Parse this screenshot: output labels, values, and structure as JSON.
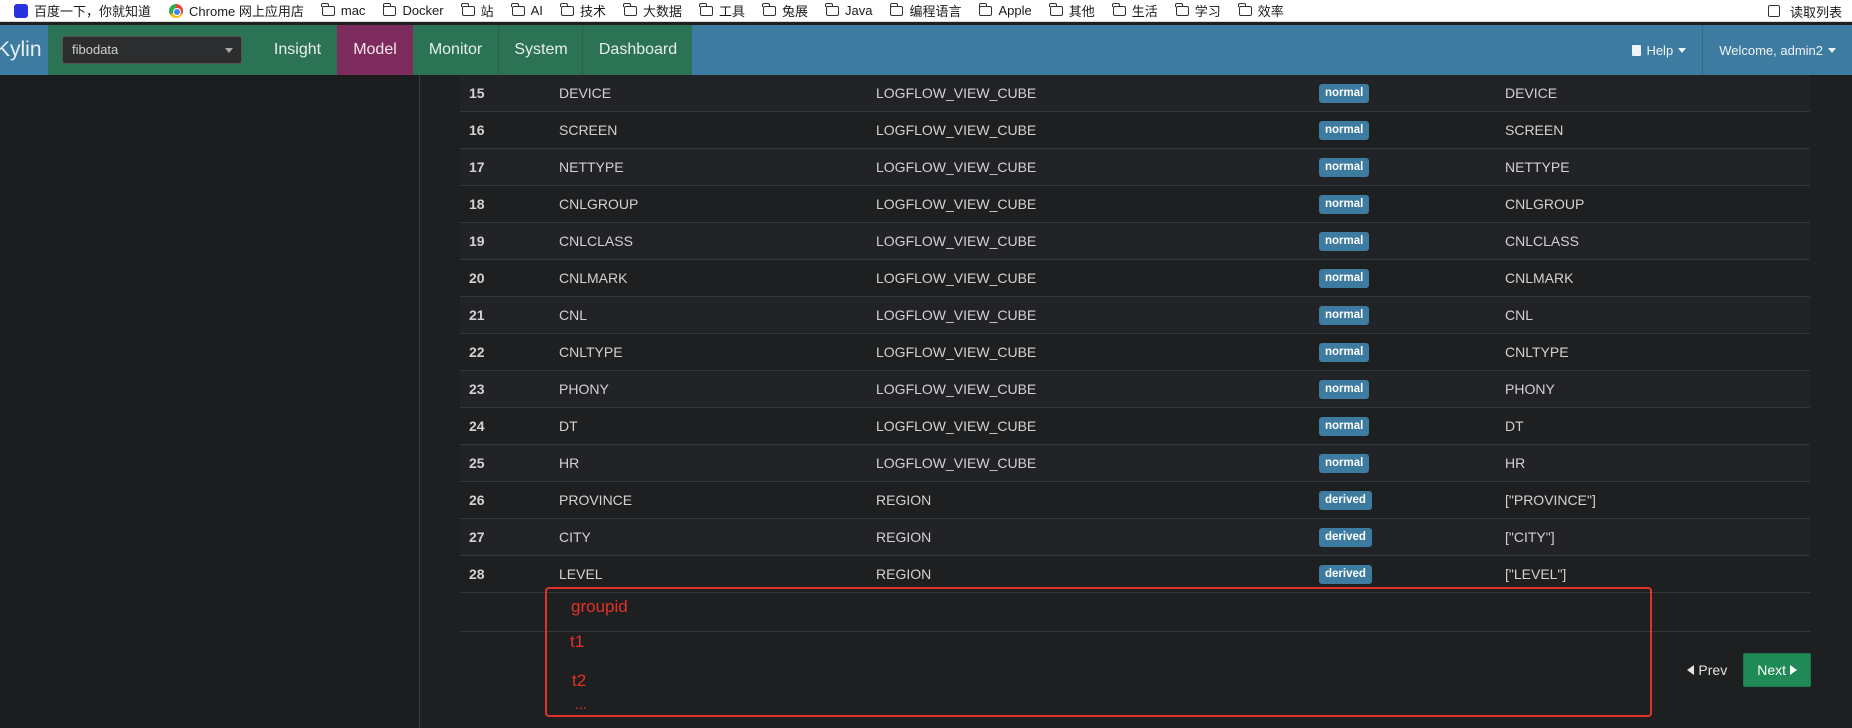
{
  "bookmarks": {
    "items": [
      {
        "label": "百度一下，你就知道",
        "icon": "baidu-icon"
      },
      {
        "label": "Chrome 网上应用店",
        "icon": "chrome-icon"
      },
      {
        "label": "mac",
        "icon": "folder-icon"
      },
      {
        "label": "Docker",
        "icon": "folder-icon"
      },
      {
        "label": "站",
        "icon": "folder-icon"
      },
      {
        "label": "AI",
        "icon": "folder-icon"
      },
      {
        "label": "技术",
        "icon": "folder-icon"
      },
      {
        "label": "大数据",
        "icon": "folder-icon"
      },
      {
        "label": "工具",
        "icon": "folder-icon"
      },
      {
        "label": "兔展",
        "icon": "folder-icon"
      },
      {
        "label": "Java",
        "icon": "folder-icon"
      },
      {
        "label": "编程语言",
        "icon": "folder-icon"
      },
      {
        "label": "Apple",
        "icon": "folder-icon"
      },
      {
        "label": "其他",
        "icon": "folder-icon"
      },
      {
        "label": "生活",
        "icon": "folder-icon"
      },
      {
        "label": "学习",
        "icon": "folder-icon"
      },
      {
        "label": "效率",
        "icon": "folder-icon"
      }
    ],
    "reading_list": "读取列表"
  },
  "navbar": {
    "brand": "Kylin",
    "project": "fibodata",
    "tabs": [
      "Insight",
      "Model",
      "Monitor",
      "System",
      "Dashboard"
    ],
    "active_tab": "Model",
    "help": "Help",
    "welcome": "Welcome, admin2"
  },
  "colors": {
    "navbar": "#3d7ba0",
    "nav_left": "#2c7356",
    "active_tab": "#7d2b5d",
    "badge": "#3d7ba0",
    "next_button": "#1f8a56",
    "annotation": "#e3312a"
  },
  "rows": [
    {
      "id": "15",
      "name": "DEVICE",
      "table": "LOGFLOW_VIEW_CUBE",
      "type": "normal",
      "column": "DEVICE"
    },
    {
      "id": "16",
      "name": "SCREEN",
      "table": "LOGFLOW_VIEW_CUBE",
      "type": "normal",
      "column": "SCREEN"
    },
    {
      "id": "17",
      "name": "NETTYPE",
      "table": "LOGFLOW_VIEW_CUBE",
      "type": "normal",
      "column": "NETTYPE"
    },
    {
      "id": "18",
      "name": "CNLGROUP",
      "table": "LOGFLOW_VIEW_CUBE",
      "type": "normal",
      "column": "CNLGROUP"
    },
    {
      "id": "19",
      "name": "CNLCLASS",
      "table": "LOGFLOW_VIEW_CUBE",
      "type": "normal",
      "column": "CNLCLASS"
    },
    {
      "id": "20",
      "name": "CNLMARK",
      "table": "LOGFLOW_VIEW_CUBE",
      "type": "normal",
      "column": "CNLMARK"
    },
    {
      "id": "21",
      "name": "CNL",
      "table": "LOGFLOW_VIEW_CUBE",
      "type": "normal",
      "column": "CNL"
    },
    {
      "id": "22",
      "name": "CNLTYPE",
      "table": "LOGFLOW_VIEW_CUBE",
      "type": "normal",
      "column": "CNLTYPE"
    },
    {
      "id": "23",
      "name": "PHONY",
      "table": "LOGFLOW_VIEW_CUBE",
      "type": "normal",
      "column": "PHONY"
    },
    {
      "id": "24",
      "name": "DT",
      "table": "LOGFLOW_VIEW_CUBE",
      "type": "normal",
      "column": "DT"
    },
    {
      "id": "25",
      "name": "HR",
      "table": "LOGFLOW_VIEW_CUBE",
      "type": "normal",
      "column": "HR"
    },
    {
      "id": "26",
      "name": "PROVINCE",
      "table": "REGION",
      "type": "derived",
      "column": "[\"PROVINCE\"]"
    },
    {
      "id": "27",
      "name": "CITY",
      "table": "REGION",
      "type": "derived",
      "column": "[\"CITY\"]"
    },
    {
      "id": "28",
      "name": "LEVEL",
      "table": "REGION",
      "type": "derived",
      "column": "[\"LEVEL\"]"
    }
  ],
  "pagination": {
    "prev": "Prev",
    "next": "Next"
  },
  "annotation": {
    "lines": [
      "groupid",
      "t1",
      "t2",
      "..."
    ]
  }
}
